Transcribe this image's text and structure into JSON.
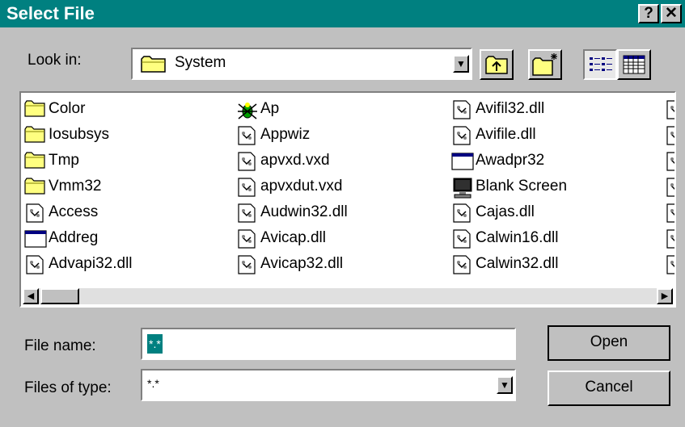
{
  "window": {
    "title": "Select File",
    "help": "?",
    "close": "✕"
  },
  "look_in": {
    "label": "Look in:",
    "value": "System"
  },
  "toolbar": {
    "up_icon": "up-folder-icon",
    "new_folder_icon": "new-folder-icon",
    "list_icon": "list-view-icon",
    "details_icon": "details-view-icon"
  },
  "files": {
    "col1": [
      {
        "name": "Color",
        "icon": "folder"
      },
      {
        "name": "Iosubsys",
        "icon": "folder"
      },
      {
        "name": "Tmp",
        "icon": "folder"
      },
      {
        "name": "Vmm32",
        "icon": "folder"
      },
      {
        "name": "Access",
        "icon": "file"
      },
      {
        "name": "Addreg",
        "icon": "app"
      },
      {
        "name": "Advapi32.dll",
        "icon": "file"
      }
    ],
    "col2": [
      {
        "name": "Ap",
        "icon": "bug"
      },
      {
        "name": "Appwiz",
        "icon": "file"
      },
      {
        "name": "apvxd.vxd",
        "icon": "file"
      },
      {
        "name": "apvxdut.vxd",
        "icon": "file"
      },
      {
        "name": "Audwin32.dll",
        "icon": "file"
      },
      {
        "name": "Avicap.dll",
        "icon": "file"
      },
      {
        "name": "Avicap32.dll",
        "icon": "file"
      }
    ],
    "col3": [
      {
        "name": "Avifil32.dll",
        "icon": "file"
      },
      {
        "name": "Avifile.dll",
        "icon": "file"
      },
      {
        "name": "Awadpr32",
        "icon": "app"
      },
      {
        "name": "Blank Screen",
        "icon": "monitor"
      },
      {
        "name": "Cajas.dll",
        "icon": "file"
      },
      {
        "name": "Calwin16.dll",
        "icon": "file"
      },
      {
        "name": "Calwin32.dll",
        "icon": "file"
      }
    ]
  },
  "file_name": {
    "label": "File name:",
    "value": "*.*"
  },
  "file_type": {
    "label": "Files of type:",
    "value": "*.*"
  },
  "buttons": {
    "open": "Open",
    "cancel": "Cancel"
  },
  "colors": {
    "title_bar": "#008080",
    "face": "#c0c0c0",
    "selection": "#008080"
  }
}
